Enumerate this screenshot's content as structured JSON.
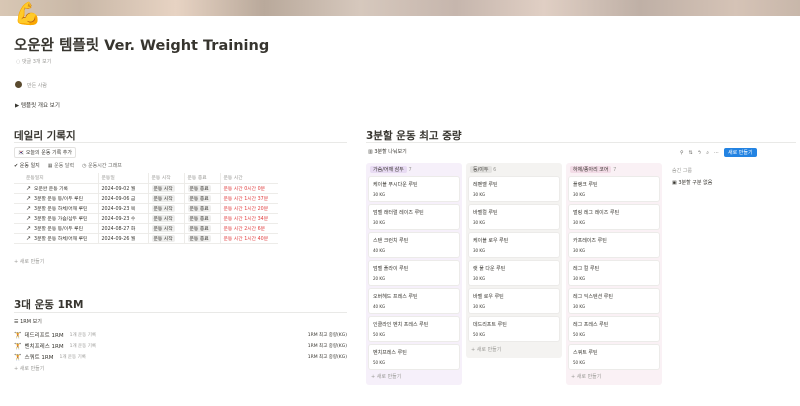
{
  "page": {
    "icon": "flexed-biceps-icon",
    "title": "오운완 템플릿 Ver. Weight Training",
    "comment_link": "댓글 3개 보기",
    "owner_link": "만든 사람",
    "toggle_label": "템플릿 개요 보기"
  },
  "daily": {
    "heading": "데일리 기록지",
    "add_button": "오늘의 운동 기록 추가",
    "tabs": [
      "운동 일지",
      "운동 달력",
      "운동시간 그래프"
    ],
    "columns": [
      "운동일지",
      "운동일",
      "운동 시작",
      "운동 종료",
      "운동 시간"
    ],
    "rows": [
      {
        "name": "오운완 운동 기록",
        "date": "2024-09-02 월",
        "start": "운동 시작",
        "end": "운동 종료",
        "time": "운동 시간 0시간 0분"
      },
      {
        "name": "3분할 운동 등/이두 루틴",
        "date": "2024-09-06 금",
        "start": "운동 시작",
        "end": "운동 종료",
        "time": "운동 시간 1시간 37분"
      },
      {
        "name": "3분할 운동 하체/어깨 루틴",
        "date": "2024-09-23 목",
        "start": "운동 시작",
        "end": "운동 종료",
        "time": "운동 시간 1시간 20분"
      },
      {
        "name": "3분할 운동 가슴/삼두 루틴",
        "date": "2024-09-23 수",
        "start": "운동 시작",
        "end": "운동 종료",
        "time": "운동 시간 1시간 34분"
      },
      {
        "name": "3분할 운동 등/이두 루틴",
        "date": "2024-08-27 화",
        "start": "운동 시작",
        "end": "운동 종료",
        "time": "운동 시간 2시간 6분"
      },
      {
        "name": "3분할 운동 하체/어깨 루틴",
        "date": "2024-09-26 월",
        "start": "운동 시작",
        "end": "운동 종료",
        "time": "운동 시간 1시간 40분"
      }
    ],
    "new_label": "새로 만들기"
  },
  "rm": {
    "heading": "3대 운동 1RM",
    "view_label": "1RM 보기",
    "rows": [
      {
        "name": "데드리프트 1RM",
        "sub": "1개 운동 기록",
        "right": "1RM 최고 중량(KG)"
      },
      {
        "name": "벤치프레스 1RM",
        "sub": "1개 운동 기록",
        "right": "1RM 최고 중량(KG)"
      },
      {
        "name": "스쿼트 1RM",
        "sub": "1개 운동 기록",
        "right": "1RM 최고 중량(KG)"
      }
    ],
    "new_label": "새로 만들기"
  },
  "board": {
    "heading": "3분할 운동 최고 중량",
    "view_label": "3분할 나눠보기",
    "toolbar_labels": [
      "필터",
      "정렬",
      "검색"
    ],
    "new_button": "새로 만들기",
    "hidden_group_label": "숨긴 그룹",
    "hidden_group_item": "3분할 구분 없음",
    "colors": {
      "c1_bg": "#f6f0fa",
      "c1_tag": "#e8dbf3",
      "c2_bg": "#f4f3f1",
      "c2_tag": "#e3e2e0",
      "c3_bg": "#faf1f5",
      "c3_tag": "#f2dbe6"
    },
    "columns": [
      {
        "title": "가슴/어깨 삼두",
        "count": "7",
        "cards": [
          {
            "name": "케이블 푸시다운 루틴",
            "kg": "30 KG"
          },
          {
            "name": "덤벨 래터럴 레이즈 루틴",
            "kg": "30 KG"
          },
          {
            "name": "스탠 크런치 루틴",
            "kg": "40 KG"
          },
          {
            "name": "덤벨 플라이 루틴",
            "kg": "20 KG"
          },
          {
            "name": "오버헤드 프레스 루틴",
            "kg": "40 KG"
          },
          {
            "name": "인클라인 벤치 프레스 루틴",
            "kg": "50 KG"
          },
          {
            "name": "벤치프레스 루틴",
            "kg": "50 KG"
          }
        ]
      },
      {
        "title": "등/이두",
        "count": "6",
        "cards": [
          {
            "name": "레펜벨 루틴",
            "kg": "30 KG"
          },
          {
            "name": "바벨컬 루틴",
            "kg": "30 KG"
          },
          {
            "name": "케이블 로우 루틴",
            "kg": "30 KG"
          },
          {
            "name": "랫 풀 다운 루틴",
            "kg": "30 KG"
          },
          {
            "name": "바벨 로우 루틴",
            "kg": "30 KG"
          },
          {
            "name": "데드리프트 루틴",
            "kg": "50 KG"
          }
        ]
      },
      {
        "title": "하체/종아리 코어",
        "count": "7",
        "cards": [
          {
            "name": "플랭크 루틴",
            "kg": "30 KG"
          },
          {
            "name": "벌링 레그 레이즈 루틴",
            "kg": "30 KG"
          },
          {
            "name": "카프레이즈 루틴",
            "kg": "30 KG"
          },
          {
            "name": "레그 컬 루틴",
            "kg": "30 KG"
          },
          {
            "name": "레그 익스텐션 루틴",
            "kg": "30 KG"
          },
          {
            "name": "레그 프레스 루틴",
            "kg": "50 KG"
          },
          {
            "name": "스쿼트 루틴",
            "kg": "50 KG"
          }
        ]
      }
    ],
    "new_label": "새로 만들기"
  }
}
